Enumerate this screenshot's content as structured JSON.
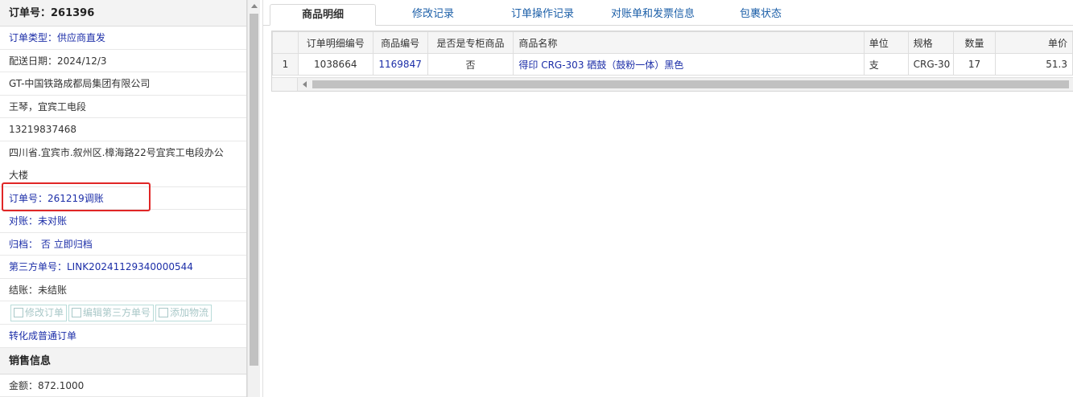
{
  "order": {
    "title": "订单号：261396",
    "type": "订单类型：供应商直发",
    "delivery_date": "配送日期：2024/12/3",
    "company": "GT-中国铁路成都局集团有限公司",
    "contact": "王琴，宜宾工电段",
    "phone": "13219837468",
    "address": "四川省.宜宾市.叙州区.樟海路22号宜宾工电段办公大楼",
    "order_ref": "订单号：261219调账",
    "reconcile": "对账：未对账",
    "archive_label": "归档：",
    "archive_value": "否",
    "archive_action": "立即归档",
    "third_party_no": "第三方单号：LINK20241129340000544",
    "settle": "结账：未结账",
    "btn_edit_order": "修改订单",
    "btn_edit_third": "编辑第三方单号",
    "btn_add_logistics": "添加物流",
    "convert_link": "转化成普通订单",
    "sales_header": "销售信息",
    "amount": "金额：872.1000"
  },
  "tabs": [
    {
      "label": "商品明细",
      "active": true
    },
    {
      "label": "修改记录",
      "active": false
    },
    {
      "label": "订单操作记录",
      "active": false
    },
    {
      "label": "对账单和发票信息",
      "active": false
    },
    {
      "label": "包裹状态",
      "active": false
    }
  ],
  "grid": {
    "columns": [
      "",
      "订单明细编号",
      "商品编号",
      "是否是专柜商品",
      "商品名称",
      "单位",
      "规格",
      "数量",
      "单价"
    ],
    "rows": [
      [
        "1",
        "1038664",
        "1169847",
        "否",
        "得印 CRG-303 硒鼓（鼓粉一体）黑色",
        "支",
        "CRG-30",
        "17",
        "51.3"
      ]
    ]
  },
  "icons": [
    "edit-icon",
    "scroll-up-arrow-icon",
    "scroll-left-arrow-icon"
  ],
  "colors": {
    "link": "#1c2ea8",
    "highlight": "#e02626",
    "tab_text": "#1c5fa8"
  }
}
